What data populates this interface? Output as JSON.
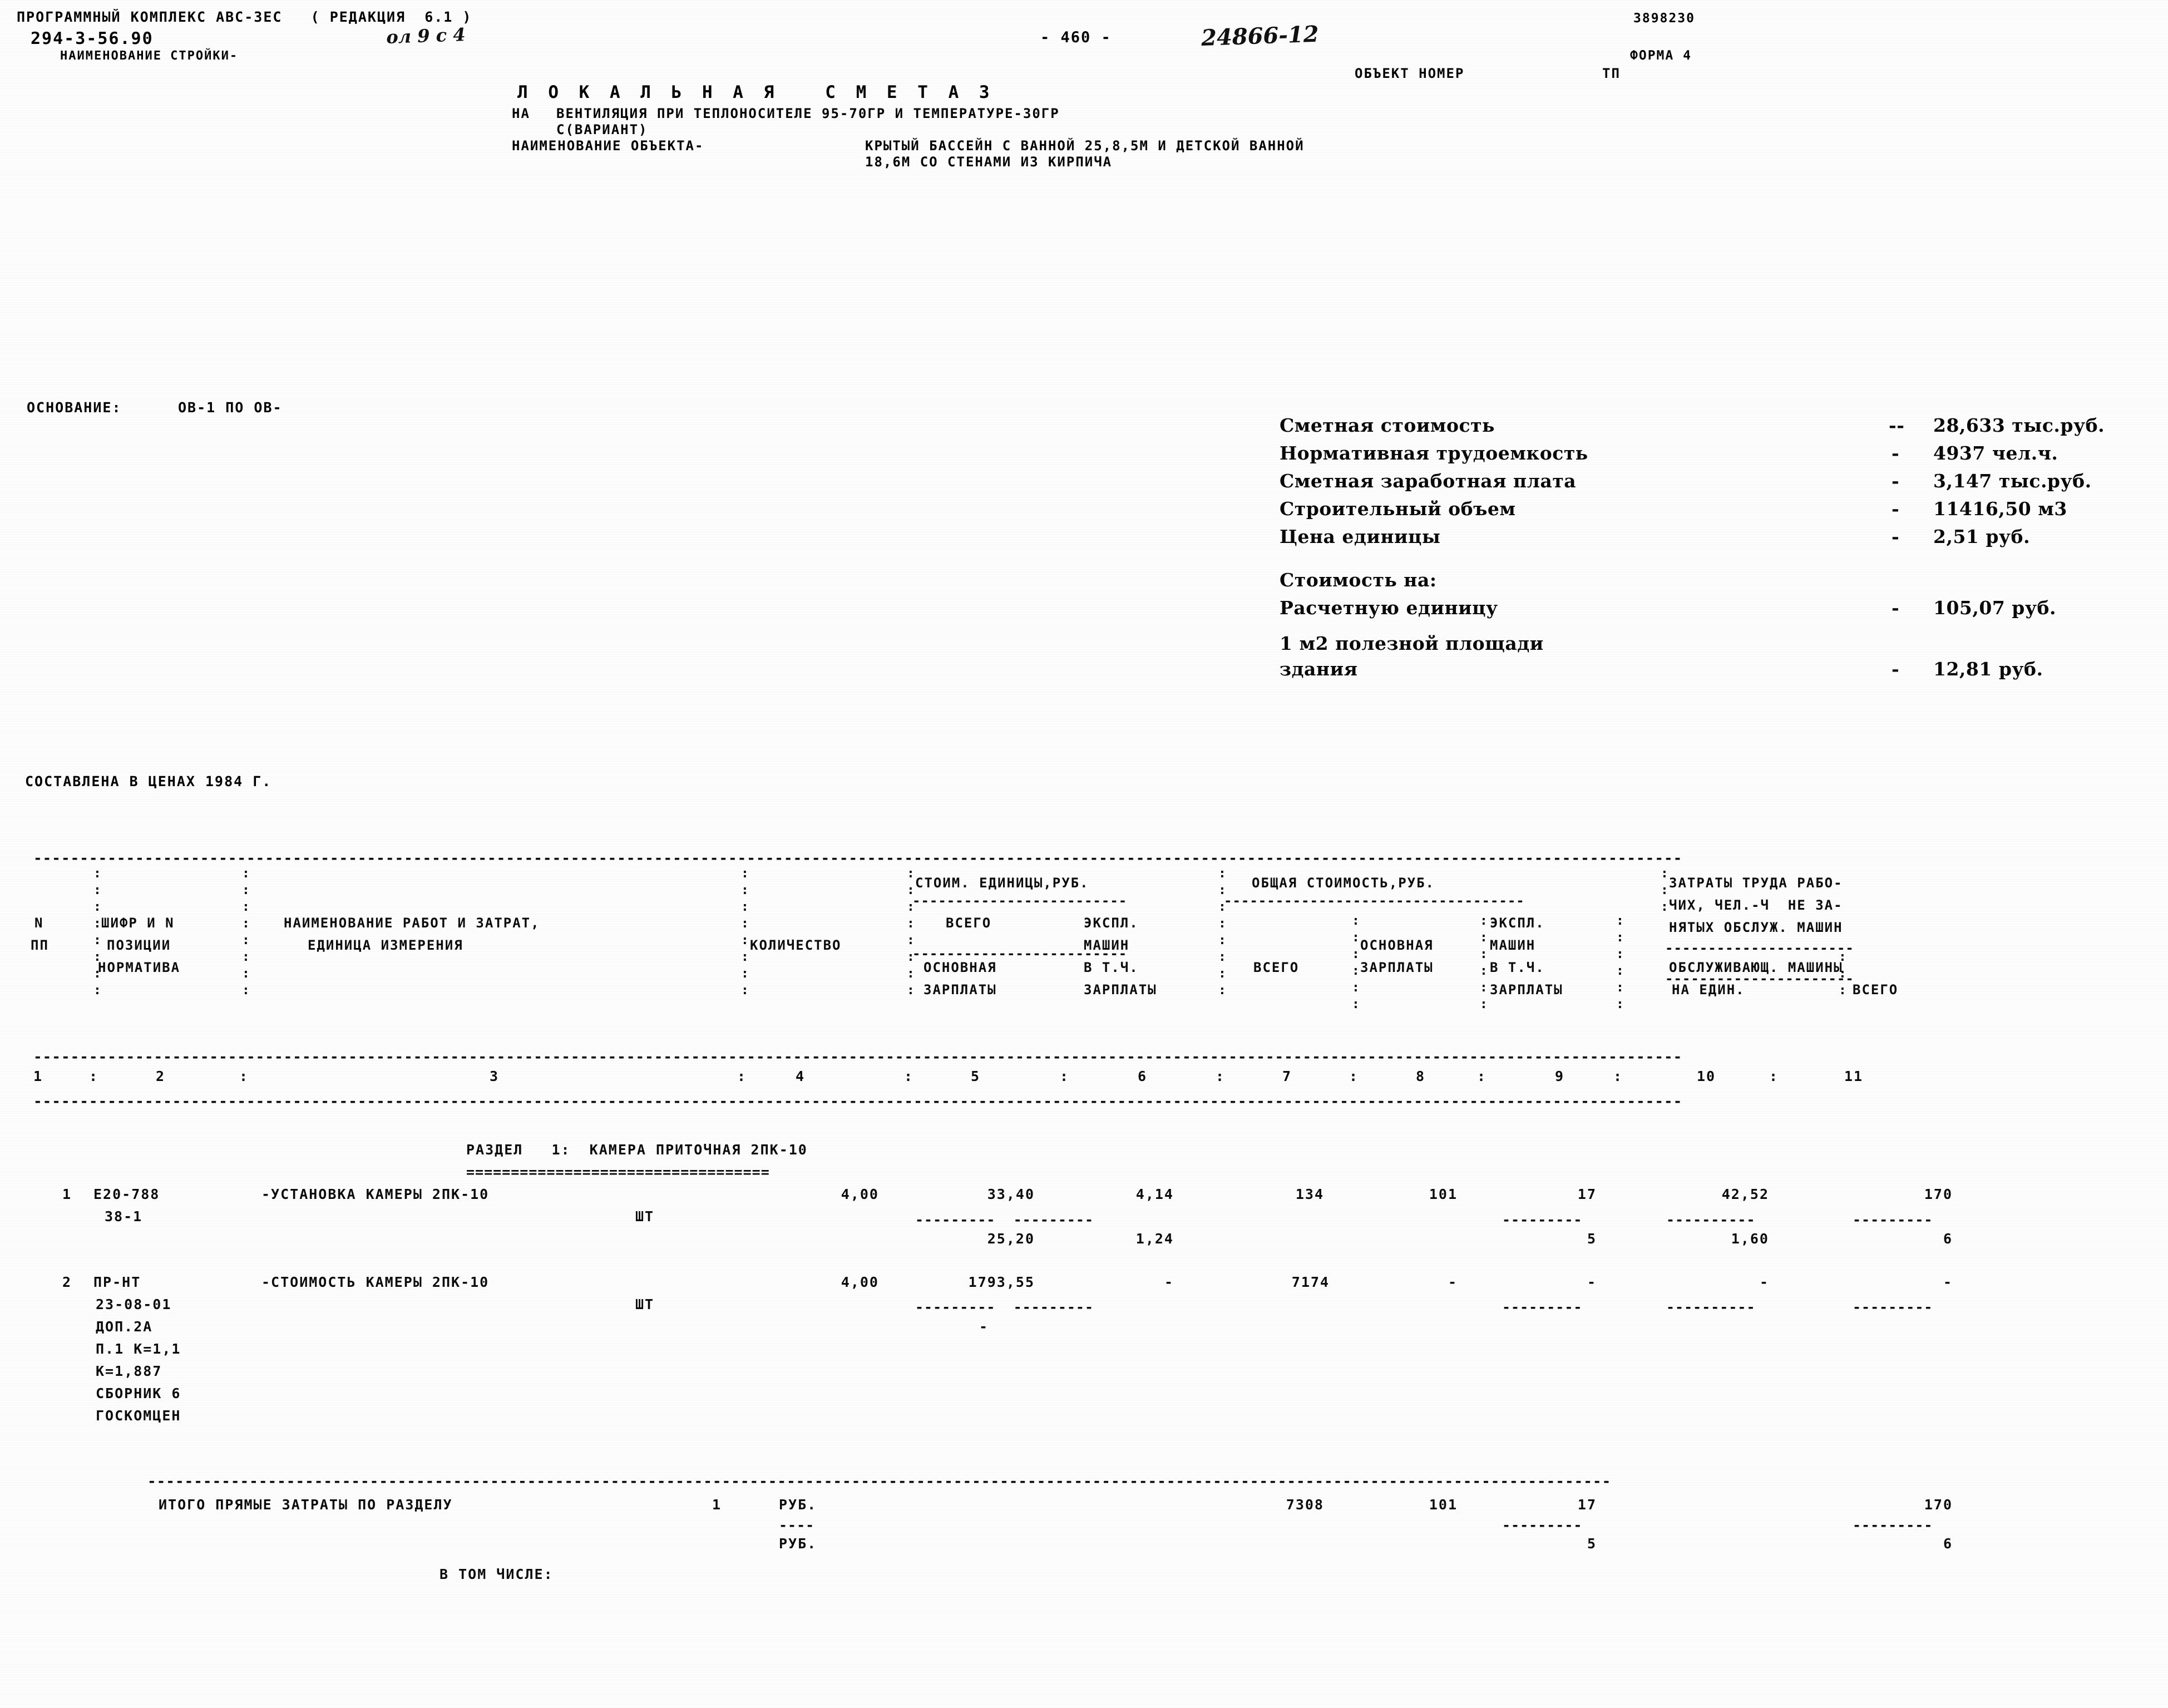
{
  "header": {
    "program_line": "ПРОГРАММНЫЙ КОМПЛЕКС АВС-ЗЕС   ( РЕДАКЦИЯ  6.1 )",
    "project_code": "294-3-56.90",
    "handwritten_sheet": "ол 9 с 4",
    "construction_name_label": "НАИМЕНОВАНИЕ СТРОЙКИ-",
    "page_number": "- 460 -",
    "handwritten_number": "24866-12",
    "doc_number": "3898230",
    "form_label": "ФОРМА 4",
    "object_number_label": "ОБЪЕКТ НОМЕР",
    "object_number_value": "ТП"
  },
  "title": {
    "main": "Л О К А Л Ь Н А Я   С М Е Т А 3",
    "purpose_label": "НА",
    "purpose_line1": "ВЕНТИЛЯЦИЯ ПРИ ТЕПЛОНОСИТЕЛЕ 95-70ГР И ТЕМПЕРАТУРЕ-30ГР",
    "purpose_line2": "С(ВАРИАНТ)",
    "object_name_label": "НАИМЕНОВАНИЕ ОБЪЕКТА-",
    "object_name_line1": "КРЫТЫЙ БАССЕЙН С ВАННОЙ 25,8,5М И ДЕТСКОЙ ВАННОЙ",
    "object_name_line2": "18,6М СО СТЕНАМИ ИЗ КИРПИЧА"
  },
  "basis": {
    "label": "ОСНОВАНИЕ:",
    "value": "ОВ-1 ПО ОВ-"
  },
  "prices_note": "СОСТАВЛЕНА В ЦЕНАХ 1984 Г.",
  "summary": {
    "rows": [
      {
        "label": "Сметная стоимость",
        "dash": "--",
        "value": "28,633 тыс.руб."
      },
      {
        "label": "Нормативная трудоемкость",
        "dash": "-",
        "value": "4937 чел.ч."
      },
      {
        "label": "Сметная заработная плата",
        "dash": "-",
        "value": "3,147 тыс.руб."
      },
      {
        "label": "Строительный объем",
        "dash": "-",
        "value": "11416,50 м3"
      },
      {
        "label": "Цена единицы",
        "dash": "-",
        "value": "2,51 руб."
      }
    ],
    "cost_on_label": "Стоимость на:",
    "rows2": [
      {
        "label": "Расчетную единицу",
        "dash": "-",
        "value": "105,07 руб."
      }
    ],
    "area_label_line1": "1 м2 полезной площади",
    "area_label_line2": "здания",
    "area_dash": "-",
    "area_value": "12,81 руб."
  },
  "table": {
    "headers": {
      "col1_line1": "N",
      "col1_line2": "ПП",
      "col2_line1": "ШИФР И N",
      "col2_line2": "ПОЗИЦИИ",
      "col2_line3": "НОРМАТИВА",
      "col3_line1": "НАИМЕНОВАНИЕ РАБОТ И ЗАТРАТ,",
      "col3_line2": "ЕДИНИЦА ИЗМЕРЕНИЯ",
      "col4": "КОЛИЧЕСТВО",
      "grp_unit_cost": "СТОИМ. ЕДИНИЦЫ,РУБ.",
      "grp_total_cost": "ОБЩАЯ СТОИМОСТЬ,РУБ.",
      "grp_labor_line1": "ЗАТРАТЫ ТРУДА РАБО-",
      "grp_labor_line2": "ЧИХ, ЧЕЛ.-Ч  НЕ ЗА-",
      "grp_labor_line3": "НЯТЫХ ОБСЛУЖ. МАШИН",
      "col5_line1": "ВСЕГО",
      "col5_line2": "ОСНОВНАЯ",
      "col5_line3": "ЗАРПЛАТЫ",
      "col6_line1": "ЭКСПЛ.",
      "col6_line2": "МАШИН",
      "col6_line3": "В Т.Ч.",
      "col6_line4": "ЗАРПЛАТЫ",
      "col7": "ВСЕГО",
      "col8_line1": "ОСНОВНАЯ",
      "col8_line2": "ЗАРПЛАТЫ",
      "col9_line1": "ЭКСПЛ.",
      "col9_line2": "МАШИН",
      "col9_line3": "В Т.Ч.",
      "col9_line4": "ЗАРПЛАТЫ",
      "col10_line1": "ОБСЛУЖИВАЮЩ. МАШИНЫ",
      "col10_line2": "НА ЕДИН.",
      "col11": "ВСЕГО"
    },
    "numbers": [
      "1",
      "2",
      "3",
      "4",
      "5",
      "6",
      "7",
      "8",
      "9",
      "10",
      "11"
    ],
    "section_title": "РАЗДЕЛ   1:  КАМЕРА ПРИТОЧНАЯ 2ПК-10",
    "rows": [
      {
        "n": "1",
        "code_lines": [
          "Е20-788",
          "38-1"
        ],
        "name": "-УСТАНОВКА КАМЕРЫ 2ПК-10",
        "unit": "ШТ",
        "qty": "4,00",
        "unit_total": "33,40",
        "unit_mach": "4,14",
        "unit_wage": "25,20",
        "unit_mach_wage": "1,24",
        "total": "134",
        "base_wage": "101",
        "mach": "17",
        "mach_wage": "5",
        "labor_unit": "42,52",
        "labor_unit2": "1,60",
        "labor_total": "170",
        "labor_total2": "6"
      },
      {
        "n": "2",
        "code_lines": [
          "ПР-НТ",
          "23-08-01",
          "ДОП.2А",
          "П.1 К=1,1",
          "К=1,887",
          "СБОРНИК 6",
          "ГОСКОМЦЕН"
        ],
        "name": "-СТОИМОСТЬ КАМЕРЫ 2ПК-10",
        "unit": "ШТ",
        "qty": "4,00",
        "unit_total": "1793,55",
        "unit_mach": "-",
        "unit_wage": "-",
        "total": "7174",
        "base_wage": "-",
        "mach": "-",
        "labor_unit": "-",
        "labor_total": "-"
      }
    ],
    "totals": {
      "label": "ИТОГО ПРЯМЫЕ ЗАТРАТЫ ПО РАЗДЕЛУ",
      "section_no": "1",
      "unit1": "РУБ.",
      "unit2": "РУБ.",
      "included_label": "В ТОМ ЧИСЛЕ:",
      "total": "7308",
      "base_wage": "101",
      "mach": "17",
      "mach_wage": "5",
      "labor_total": "170",
      "labor_total2": "6"
    }
  }
}
